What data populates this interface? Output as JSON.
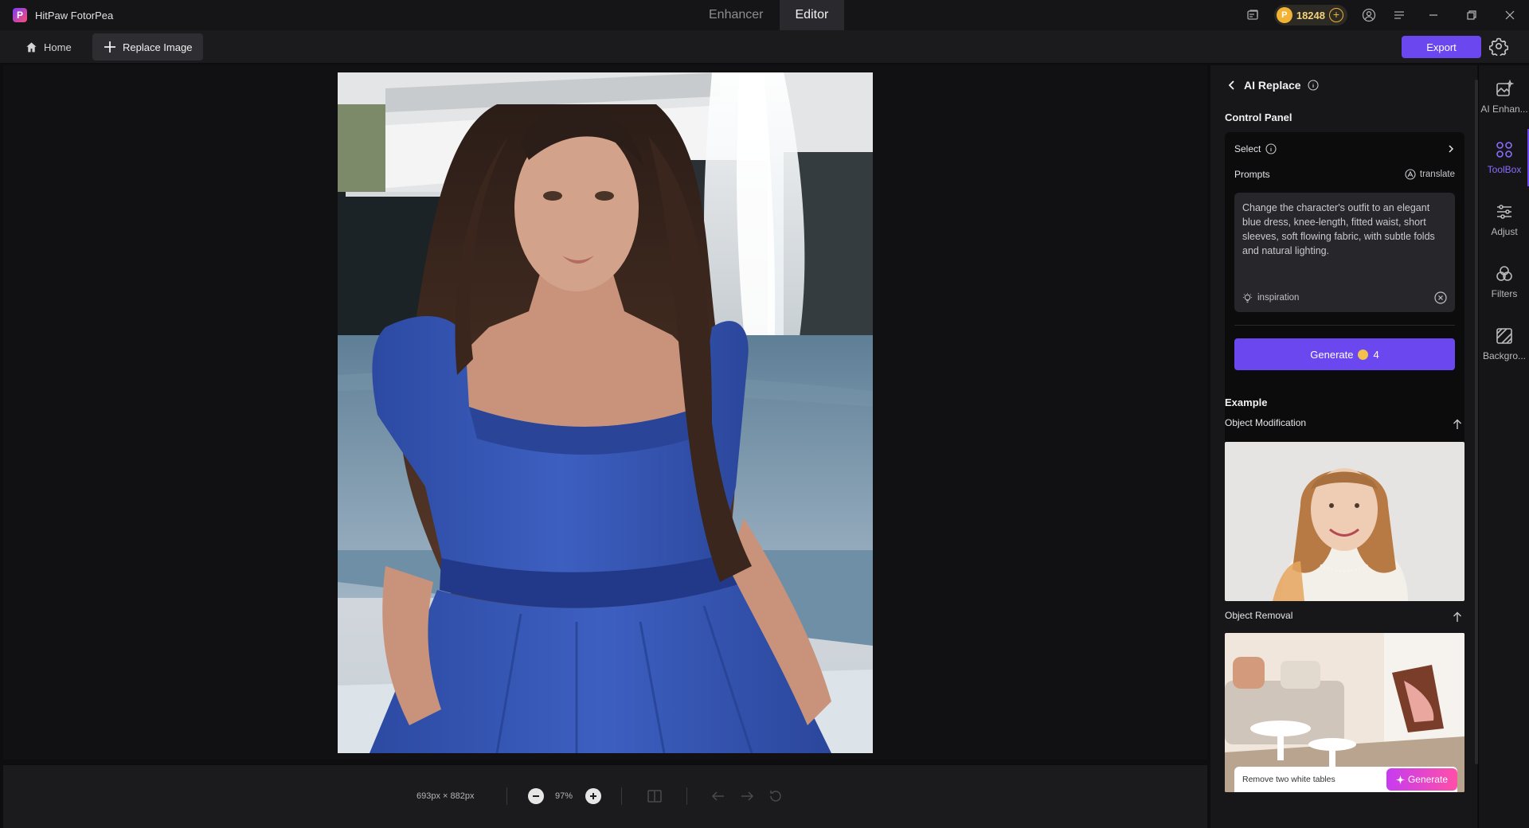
{
  "app": {
    "name": "HitPaw FotorPea",
    "logo_letter": "P"
  },
  "mode_tabs": [
    {
      "label": "Enhancer",
      "active": false
    },
    {
      "label": "Editor",
      "active": true
    }
  ],
  "coins": {
    "value": "18248"
  },
  "toolbar": {
    "home_label": "Home",
    "replace_label": "Replace Image",
    "export_label": "Export"
  },
  "canvas": {
    "image_alt": "Woman in blue dress by a fountain"
  },
  "status_bar": {
    "dimensions": "693px × 882px",
    "zoom": "97%"
  },
  "panel": {
    "title": "AI Replace",
    "control_panel_title": "Control Panel",
    "select_label": "Select",
    "prompts_label": "Prompts",
    "translate_label": "translate",
    "prompt_text": "Change the character's outfit to an elegant blue dress, knee-length, fitted waist, short sleeves, soft flowing fabric, with subtle folds and natural lighting.",
    "inspiration_label": "inspiration",
    "generate_label": "Generate",
    "generate_cost": "4",
    "example_title": "Example",
    "examples": [
      {
        "label": "Object Modification"
      },
      {
        "label": "Object Removal",
        "prompt": "Remove two white tables",
        "button": "Generate"
      }
    ]
  },
  "rail": [
    {
      "label": "AI Enhan...",
      "icon": "ai-enhance-icon",
      "active": false
    },
    {
      "label": "ToolBox",
      "icon": "toolbox-icon",
      "active": true
    },
    {
      "label": "Adjust",
      "icon": "adjust-icon",
      "active": false
    },
    {
      "label": "Filters",
      "icon": "filters-icon",
      "active": false
    },
    {
      "label": "Backgro...",
      "icon": "background-icon",
      "active": false
    }
  ],
  "colors": {
    "accent": "#6b47f0",
    "coin": "#f2b233",
    "dress": "#3656b2"
  }
}
